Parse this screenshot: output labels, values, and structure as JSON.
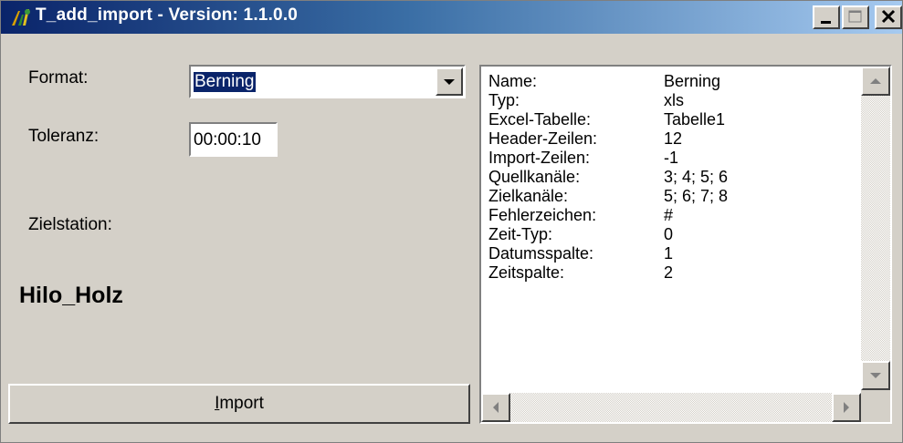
{
  "window": {
    "title": "T_add_import - Version: 1.1.0.0",
    "icon": "app-logo-icon",
    "controls": [
      "minimize-icon",
      "maximize-icon",
      "close-icon"
    ]
  },
  "form": {
    "format_label": "Format:",
    "format_value": "Berning",
    "tolerance_label": "Toleranz:",
    "tolerance_value": "00:00:10",
    "target_label": "Zielstation:",
    "target_value": "Hilo_Holz",
    "import_accel": "I",
    "import_rest": "mport"
  },
  "details": [
    {
      "key": "Name:",
      "value": "Berning"
    },
    {
      "key": "Typ:",
      "value": "xls"
    },
    {
      "key": "Excel-Tabelle:",
      "value": "Tabelle1"
    },
    {
      "key": "Header-Zeilen:",
      "value": "12"
    },
    {
      "key": "Import-Zeilen:",
      "value": "-1"
    },
    {
      "key": "Quellkanäle:",
      "value": "3; 4; 5; 6"
    },
    {
      "key": "Zielkanäle:",
      "value": "5; 6; 7; 8"
    },
    {
      "key": "Fehlerzeichen:",
      "value": "#"
    },
    {
      "key": "Zeit-Typ:",
      "value": "0"
    },
    {
      "key": "Datumsspalte:",
      "value": "1"
    },
    {
      "key": "Zeitspalte:",
      "value": "2"
    }
  ],
  "colors": {
    "titlebar_start": "#0a246a",
    "titlebar_end": "#a6caf0",
    "face": "#d4d0c8",
    "selection": "#0a246a"
  }
}
